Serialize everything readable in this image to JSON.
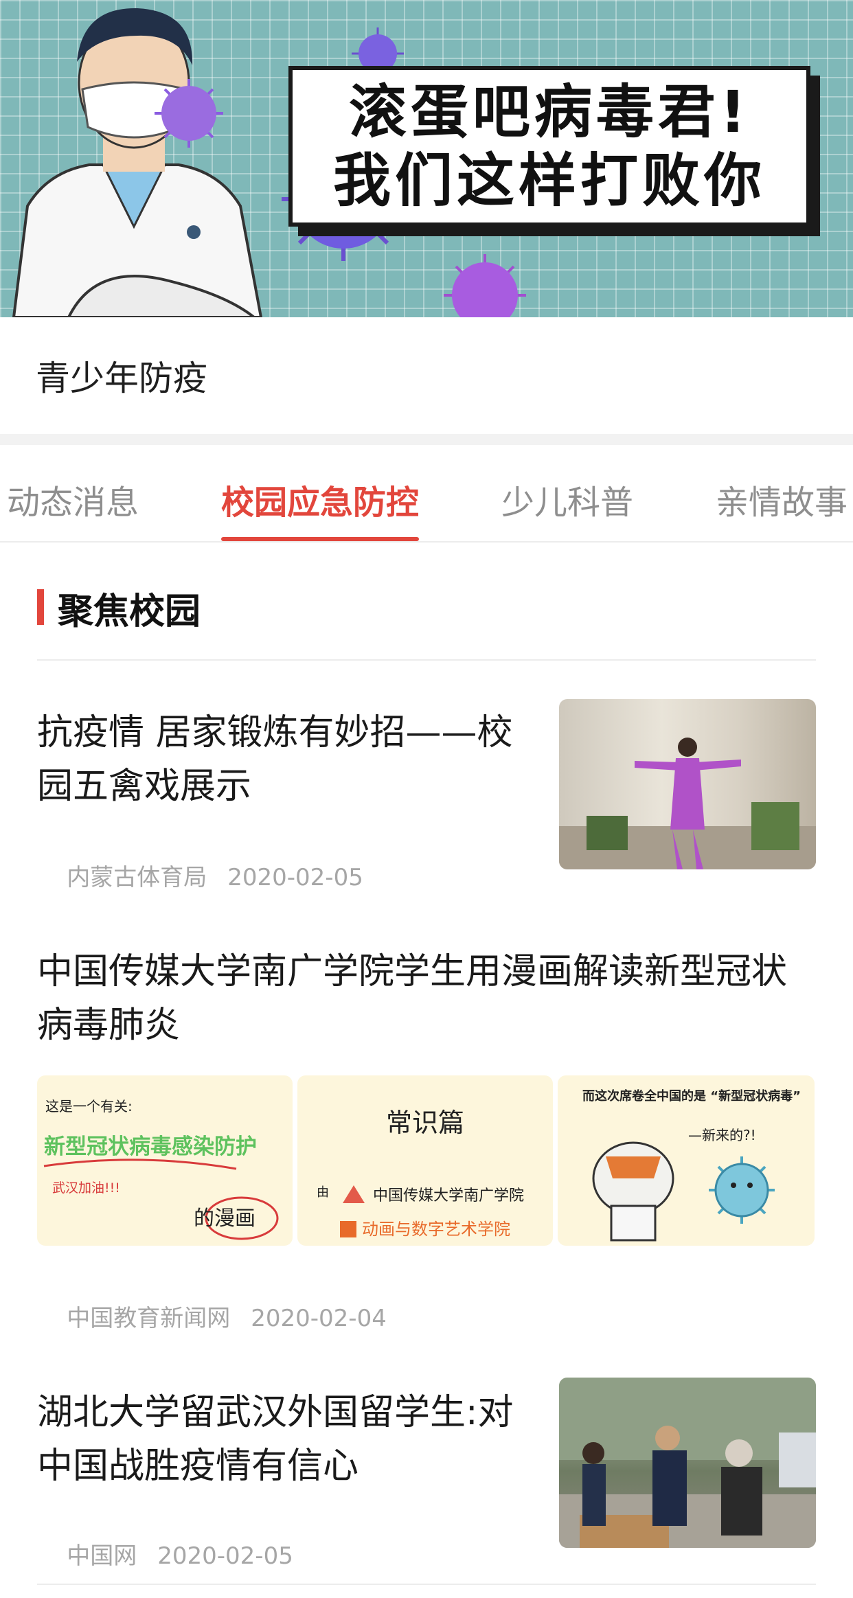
{
  "banner": {
    "line1": "滚蛋吧病毒君!",
    "line2": "我们这样打败你"
  },
  "page_title": "青少年防疫",
  "tabs": [
    {
      "label": "动态消息",
      "active": false
    },
    {
      "label": "校园应急防控",
      "active": true
    },
    {
      "label": "少儿科普",
      "active": false
    },
    {
      "label": "亲情故事",
      "active": false
    }
  ],
  "section_title": "聚焦校园",
  "articles": [
    {
      "title": "抗疫情 居家锻炼有妙招——校园五禽戏展示",
      "source": "内蒙古体育局",
      "date": "2020-02-05"
    },
    {
      "title": "中国传媒大学南广学院学生用漫画解读新型冠状病毒肺炎",
      "source": "中国教育新闻网",
      "date": "2020-02-04",
      "comic": {
        "p1_line1": "这是一个有关:",
        "p1_line2": "新型冠状病毒感染防护",
        "p1_line3": "武汉加油!!!",
        "p1_line4": "的漫画",
        "p2_line1": "常识篇",
        "p2_line2": "由",
        "p2_line3": "中国传媒大学南广学院",
        "p2_line4": "动画与数字艺术学院",
        "p3_line1": "而这次席卷全中国的是 “新型冠状病毒”",
        "p3_line2": "—新来的?!"
      }
    },
    {
      "title": "湖北大学留武汉外国留学生:对中国战胜疫情有信心",
      "source": "中国网",
      "date": "2020-02-05"
    }
  ]
}
